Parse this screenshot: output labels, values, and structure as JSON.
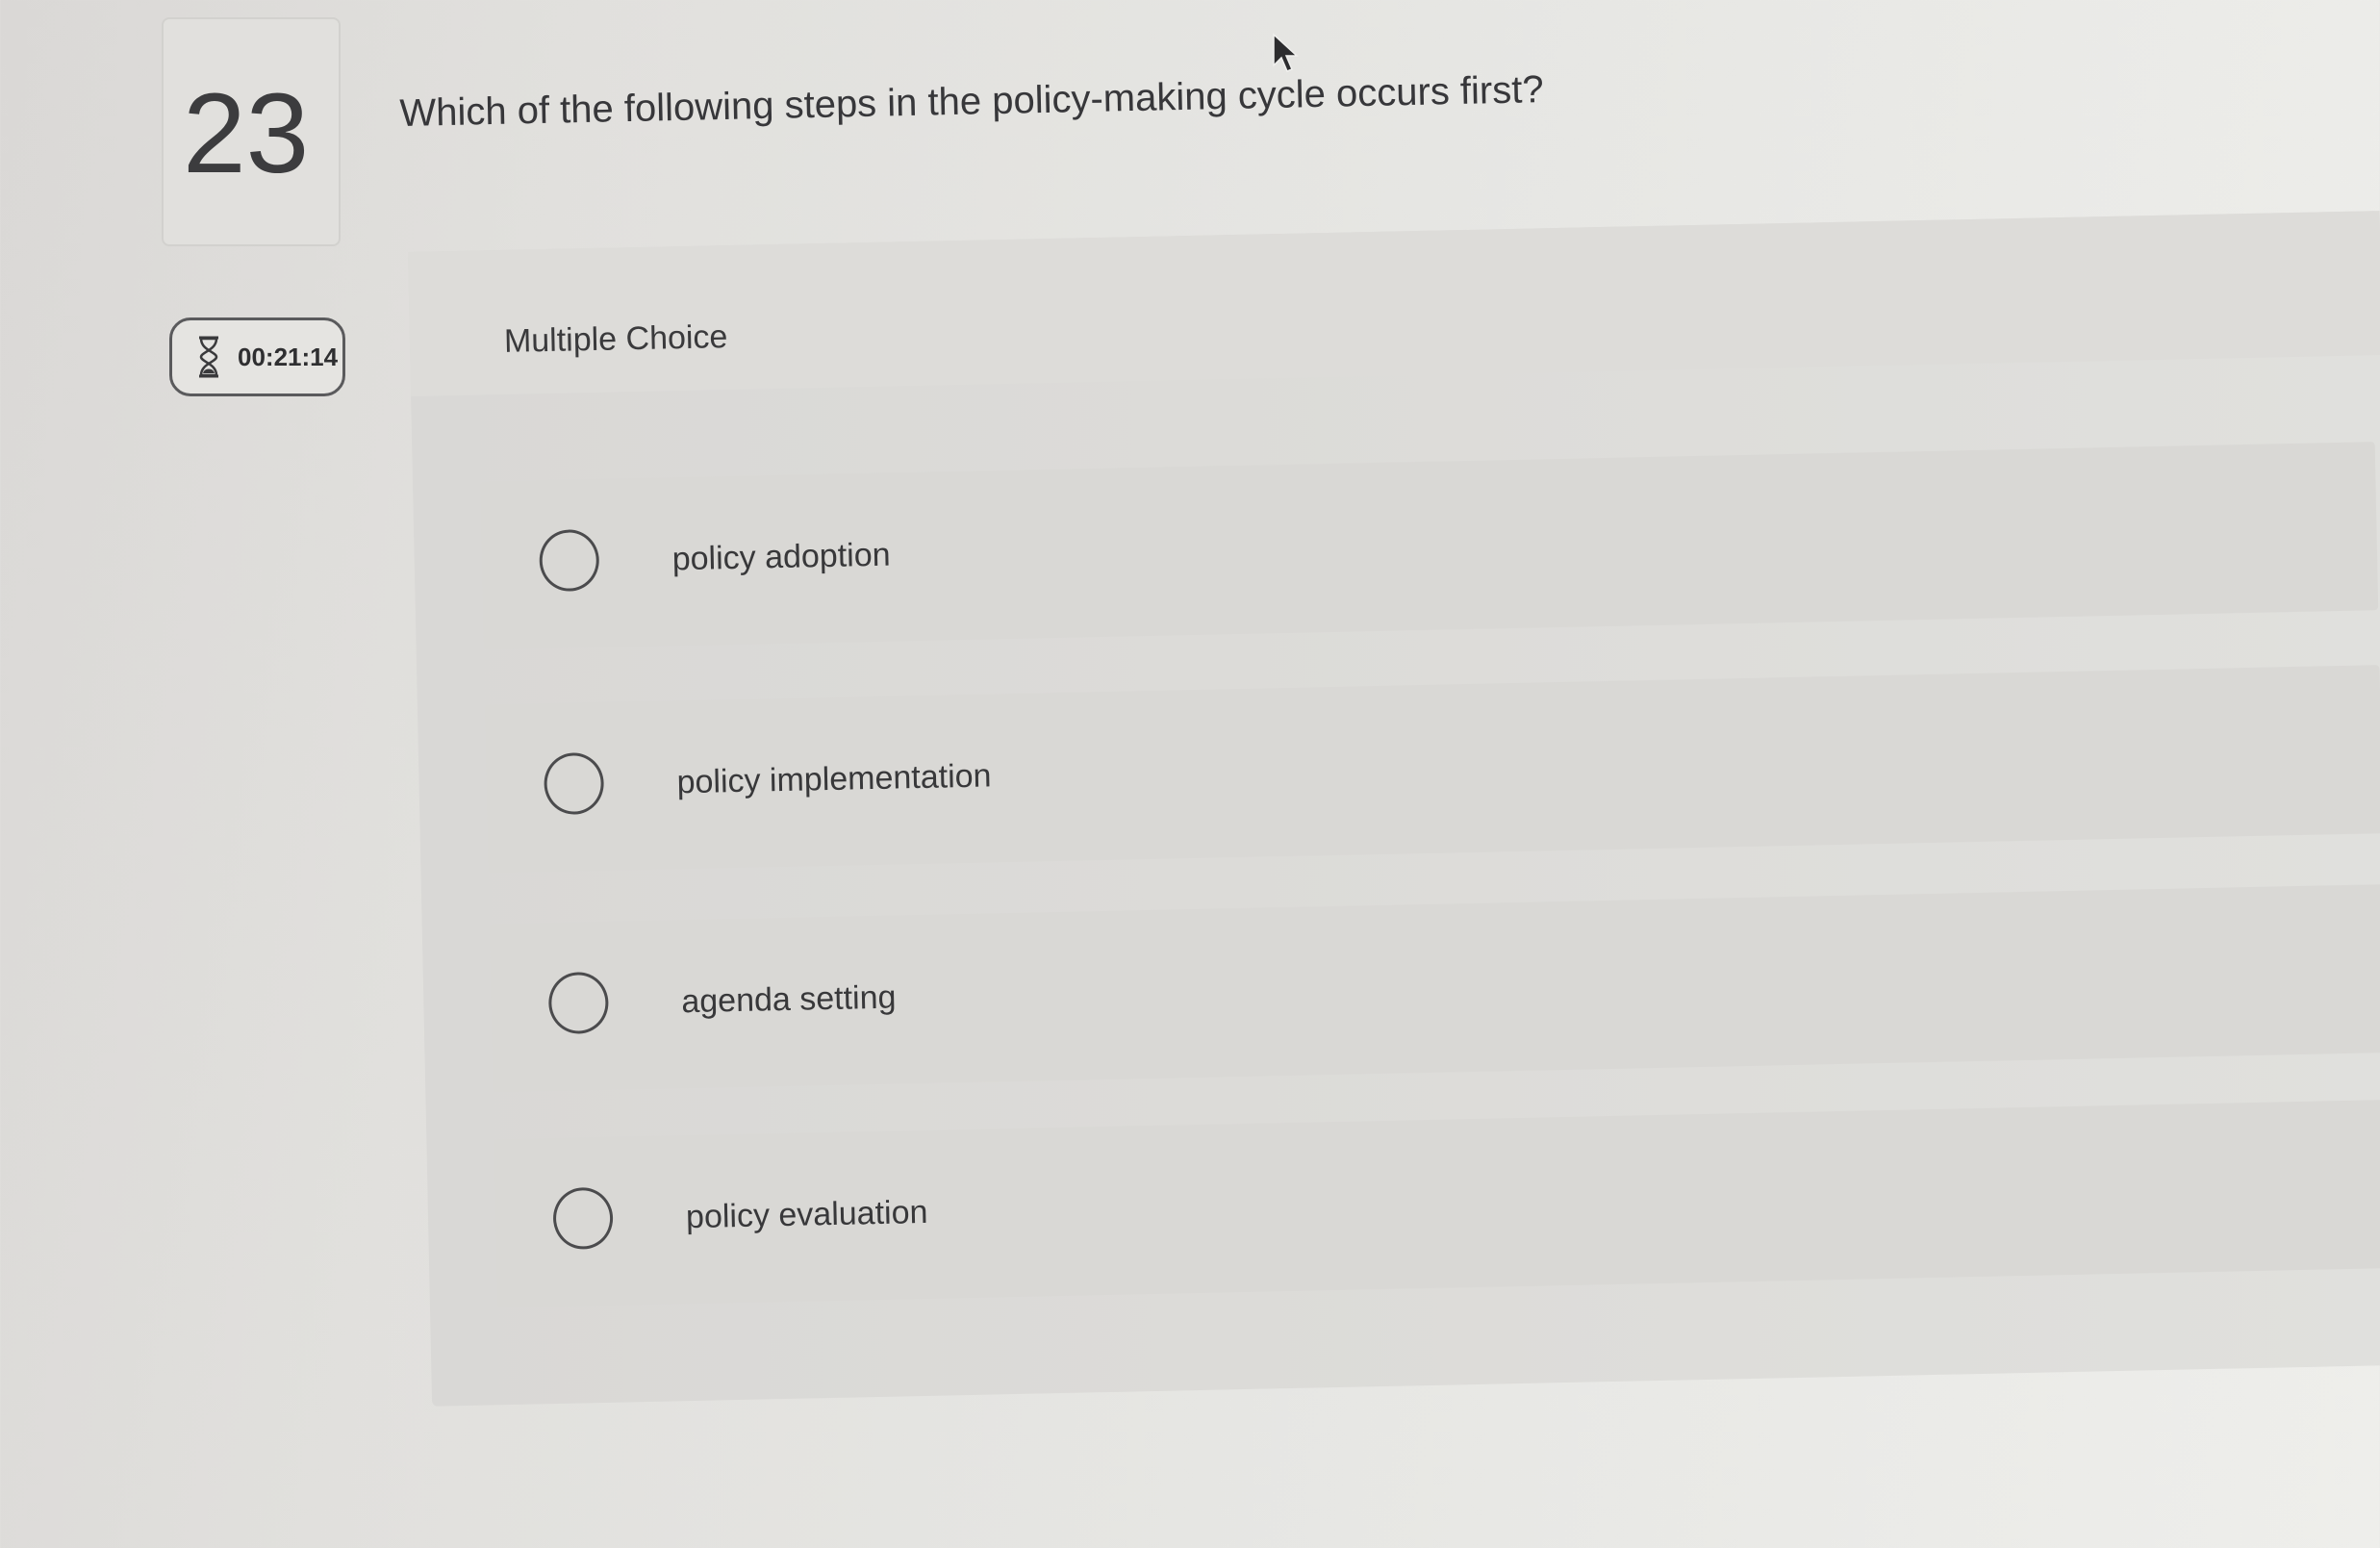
{
  "question": {
    "number": "23",
    "text": "Which of the following steps in the policy-making cycle occurs first?"
  },
  "timer": {
    "icon": "hourglass-icon",
    "value": "00:21:14"
  },
  "panel": {
    "type_label": "Multiple Choice"
  },
  "options": [
    {
      "label": "policy adoption"
    },
    {
      "label": "policy implementation"
    },
    {
      "label": "agenda setting"
    },
    {
      "label": "policy evaluation"
    }
  ]
}
